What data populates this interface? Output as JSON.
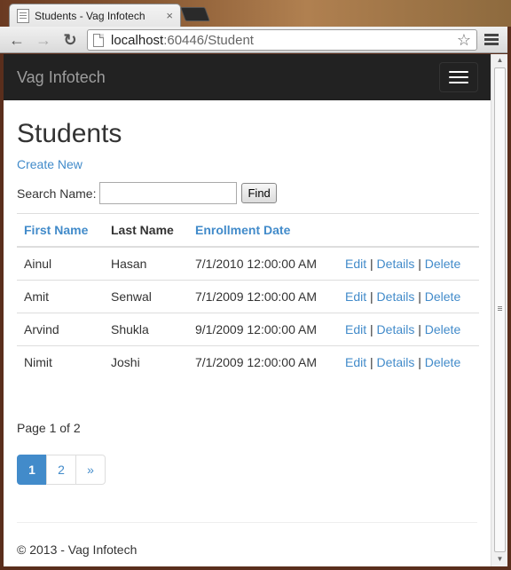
{
  "browser": {
    "tab_title": "Students - Vag Infotech",
    "tab_close": "×",
    "url_host": "localhost",
    "url_rest": ":60446/Student",
    "back": "←",
    "forward": "→",
    "reload": "↻",
    "star": "☆"
  },
  "site": {
    "brand": "Vag Infotech"
  },
  "page": {
    "title": "Students",
    "create_new": "Create New",
    "search_label": "Search Name:",
    "search_value": "",
    "find_label": "Find"
  },
  "table": {
    "headers": {
      "first_name": "First Name",
      "last_name": "Last Name",
      "enrollment_date": "Enrollment Date"
    },
    "actions": {
      "edit": "Edit",
      "details": "Details",
      "delete": "Delete",
      "separator": "|"
    },
    "rows": [
      {
        "first": "Ainul",
        "last": "Hasan",
        "date": "7/1/2010 12:00:00 AM"
      },
      {
        "first": "Amit",
        "last": "Senwal",
        "date": "7/1/2009 12:00:00 AM"
      },
      {
        "first": "Arvind",
        "last": "Shukla",
        "date": "9/1/2009 12:00:00 AM"
      },
      {
        "first": "Nimit",
        "last": "Joshi",
        "date": "7/1/2009 12:00:00 AM"
      }
    ]
  },
  "pager": {
    "text": "Page 1 of 2",
    "pages": [
      "1",
      "2",
      "»"
    ],
    "active_page": "1"
  },
  "footer": {
    "text": "© 2013 - Vag Infotech"
  },
  "colors": {
    "link": "#428bca",
    "navbar": "#222222",
    "brand": "#9d9d9d"
  }
}
